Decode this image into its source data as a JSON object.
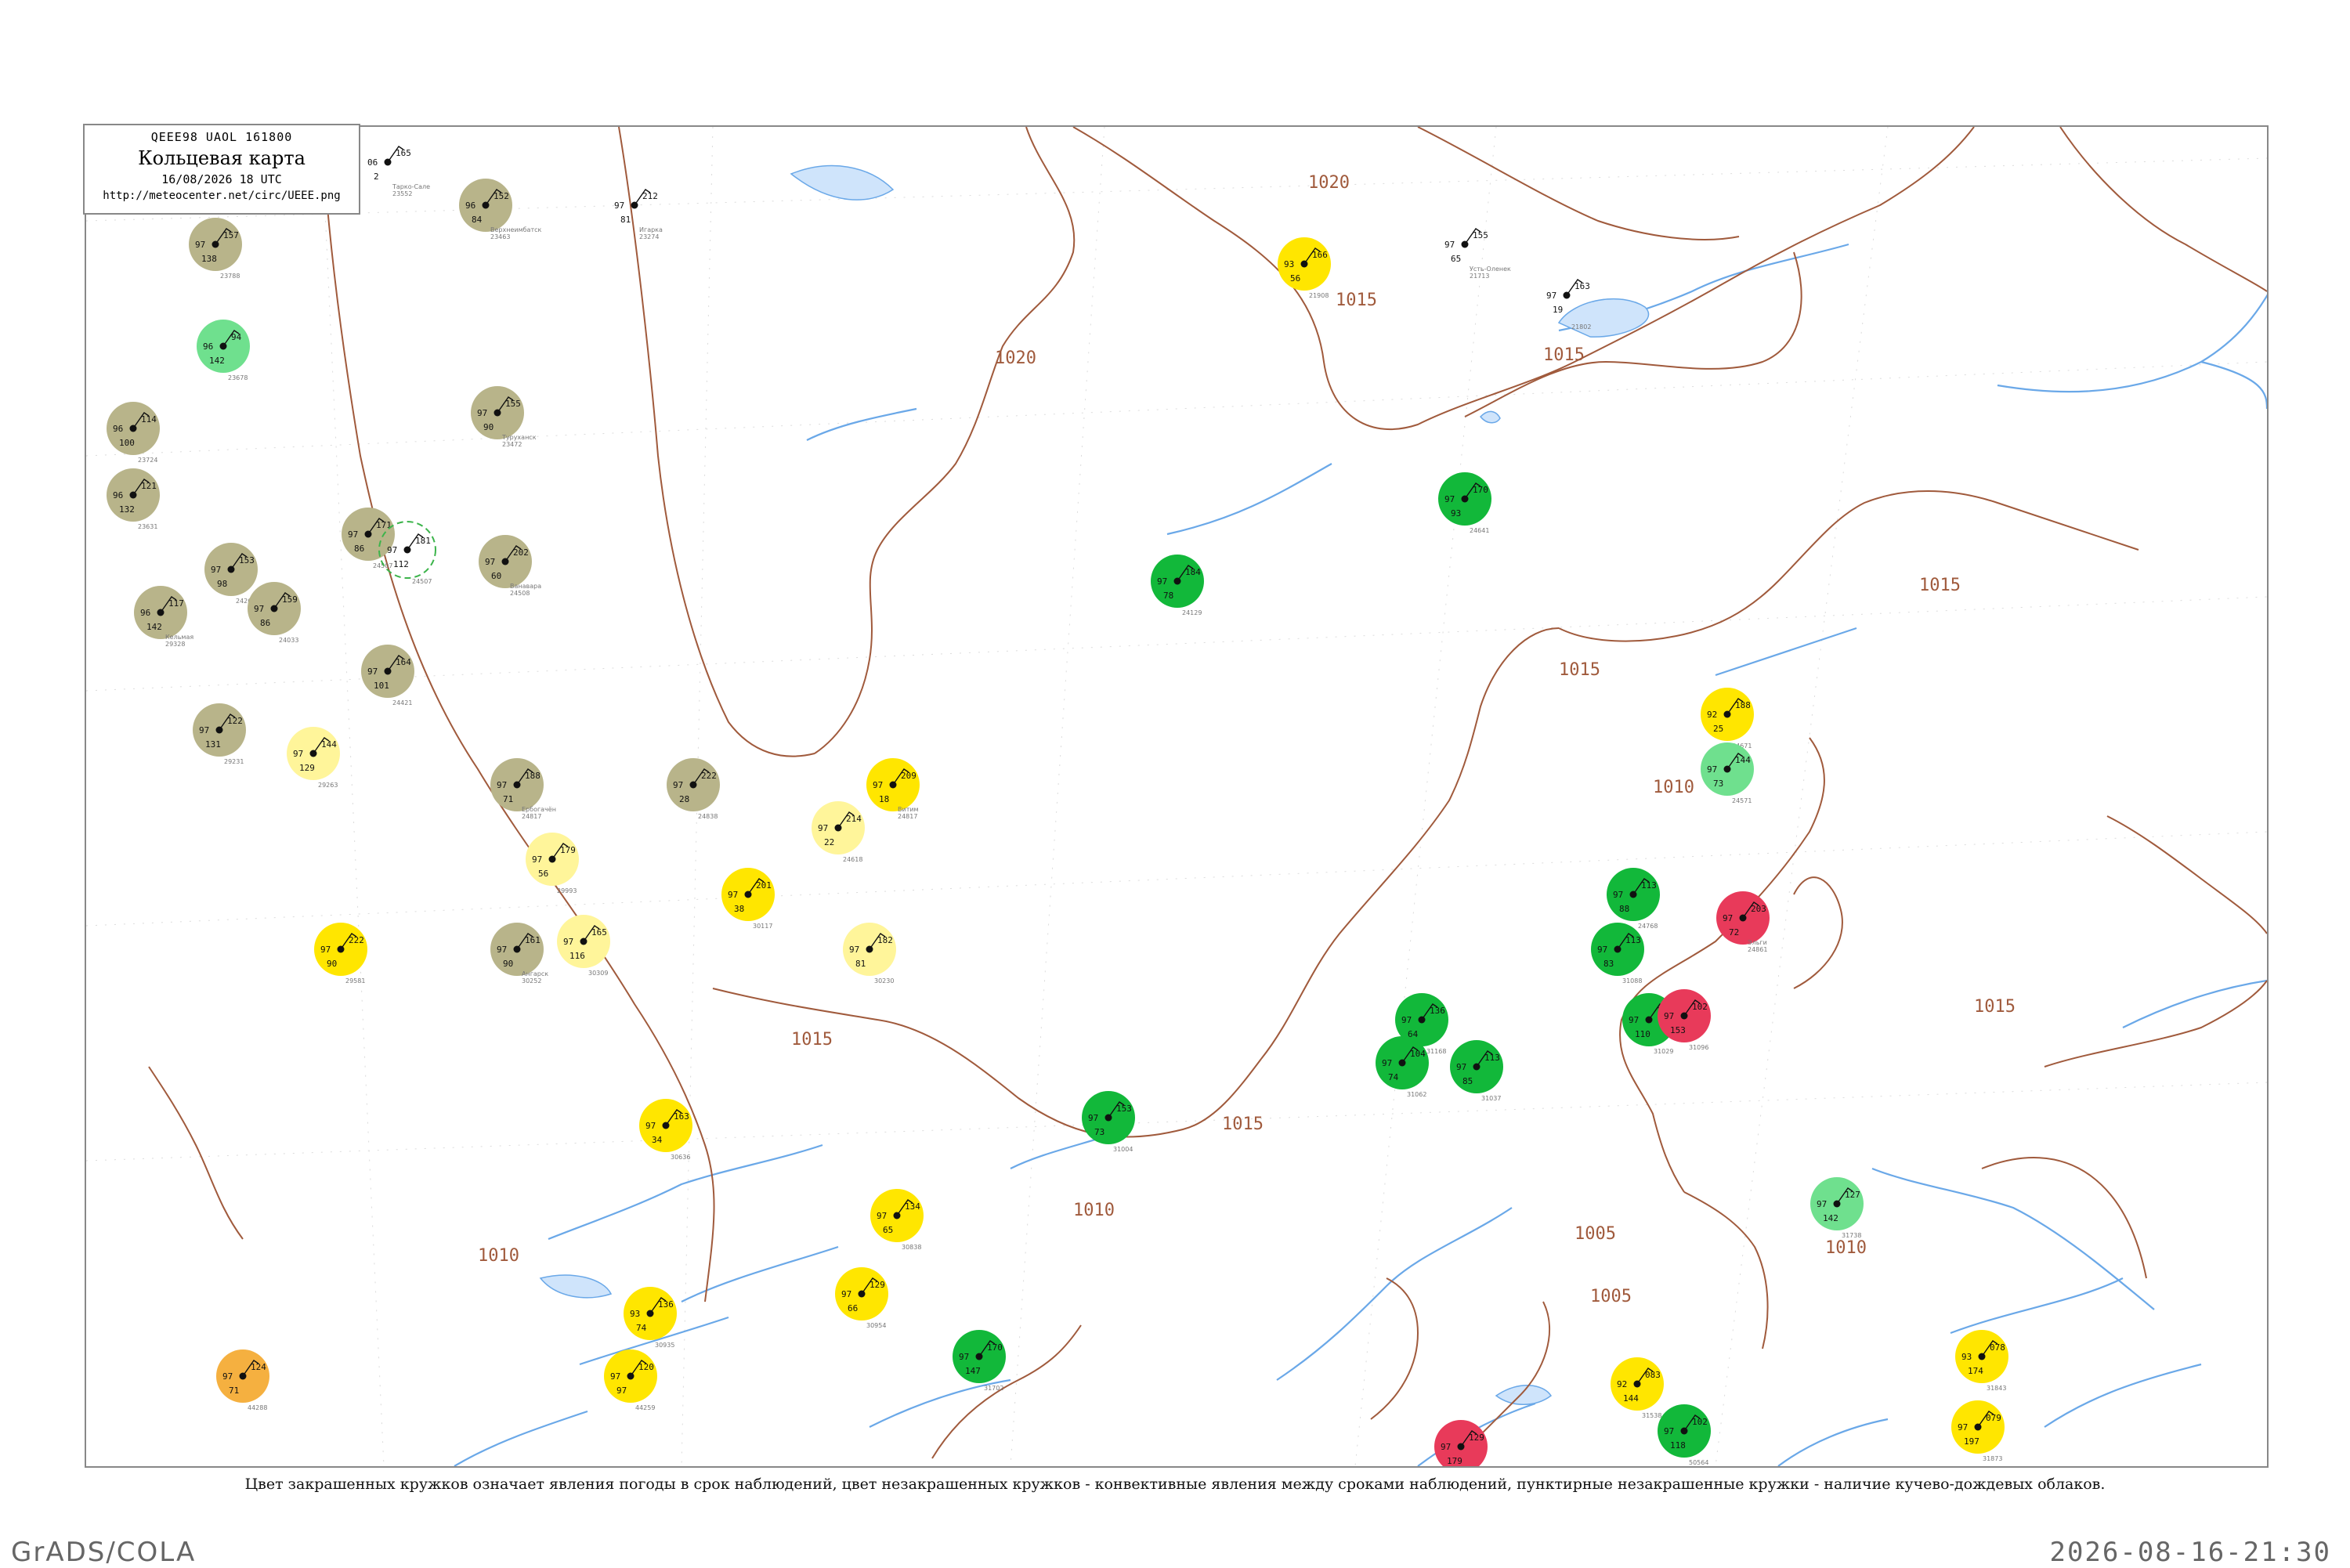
{
  "header": {
    "code": "QEEE98  UAOL  161800",
    "title": "Кольцевая карта",
    "datetime": "16/08/2026 18 UTC",
    "url": "http://meteocenter.net/circ/UEEE.png"
  },
  "caption": "Цвет закрашенных кружков означает явления погоды в срок наблюдений, цвет незакрашенных кружков - конвективные явления между сроками наблюдений, пунктирные незакрашенные кружки - наличие кучево-дождевых облаков.",
  "footer": {
    "left": "GrADS/COLA",
    "right": "2026-08-16-21:30"
  },
  "colors": {
    "isobar": "#a05a3c",
    "river": "#6aa8e8",
    "olive": "#b8b48a",
    "yellow": "#ffe600",
    "pale_yellow": "#fff59a",
    "green": "#12b83a",
    "light_green": "#6fe08e",
    "red": "#e83a5a",
    "orange": "#f5b040",
    "dashed_green": "#3cb44b",
    "dashed_red": "#e05570"
  },
  "isobar_labels": [
    "1020",
    "1015",
    "1020",
    "1015",
    "1015",
    "1010",
    "1015",
    "1010",
    "1005",
    "1010",
    "1005",
    "1015",
    "1015",
    "1010",
    "1015"
  ],
  "stations": [
    {
      "t": "165",
      "p": "06",
      "v": "2",
      "name": "Тарко-Сале",
      "id": "23552",
      "style": "none"
    },
    {
      "t": "157",
      "p": "97",
      "v": "138",
      "name": "",
      "id": "23788",
      "style": "olive"
    },
    {
      "t": "152",
      "p": "96",
      "v": "84",
      "name": "Верхнеимбатск",
      "id": "23463",
      "style": "olive"
    },
    {
      "t": "212",
      "p": "97",
      "v": "81",
      "name": "Игарка",
      "id": "23274",
      "style": "none"
    },
    {
      "t": "166",
      "p": "93",
      "v": "56",
      "name": "",
      "id": "21908",
      "style": "yellow"
    },
    {
      "t": "155",
      "p": "97",
      "v": "65",
      "name": "Усть-Оленек",
      "id": "21713",
      "style": "none"
    },
    {
      "t": "163",
      "p": "97",
      "v": "19",
      "name": "",
      "id": "21802",
      "style": "none"
    },
    {
      "t": "94",
      "p": "96",
      "v": "142",
      "name": "",
      "id": "23678",
      "style": "light_green"
    },
    {
      "t": "114",
      "p": "96",
      "v": "100",
      "name": "",
      "id": "23724",
      "style": "olive"
    },
    {
      "t": "121",
      "p": "96",
      "v": "132",
      "name": "",
      "id": "23631",
      "style": "olive"
    },
    {
      "t": "155",
      "p": "97",
      "v": "90",
      "name": "Туруханск",
      "id": "23472",
      "style": "olive"
    },
    {
      "t": "171",
      "p": "97",
      "v": "86",
      "name": "",
      "id": "24507",
      "style": "olive"
    },
    {
      "t": "181",
      "p": "97",
      "v": "112",
      "name": "",
      "id": "24507",
      "style": "dashed_green"
    },
    {
      "t": "202",
      "p": "97",
      "v": "60",
      "name": "Ванавара",
      "id": "24508",
      "style": "olive"
    },
    {
      "t": "153",
      "p": "97",
      "v": "98",
      "name": "",
      "id": "24266",
      "style": "olive"
    },
    {
      "t": "159",
      "p": "97",
      "v": "86",
      "name": "",
      "id": "24033",
      "style": "olive"
    },
    {
      "t": "117",
      "p": "96",
      "v": "142",
      "name": "Кельмая",
      "id": "29328",
      "style": "olive"
    },
    {
      "t": "164",
      "p": "97",
      "v": "101",
      "name": "",
      "id": "24421",
      "style": "olive"
    },
    {
      "t": "122",
      "p": "97",
      "v": "131",
      "name": "",
      "id": "29231",
      "style": "olive"
    },
    {
      "t": "188",
      "p": "97",
      "v": "71",
      "name": "Ербогачён",
      "id": "24817",
      "style": "olive"
    },
    {
      "t": "222",
      "p": "97",
      "v": "28",
      "name": "",
      "id": "24838",
      "style": "olive"
    },
    {
      "t": "161",
      "p": "97",
      "v": "90",
      "name": "Ангарск",
      "id": "30252",
      "style": "olive"
    },
    {
      "t": "209",
      "p": "97",
      "v": "18",
      "name": "Витим",
      "id": "24817",
      "style": "yellow"
    },
    {
      "t": "214",
      "p": "97",
      "v": "22",
      "name": "",
      "id": "24618",
      "style": "pale_yellow"
    },
    {
      "t": "201",
      "p": "97",
      "v": "38",
      "name": "",
      "id": "30117",
      "style": "yellow"
    },
    {
      "t": "182",
      "p": "97",
      "v": "81",
      "name": "",
      "id": "30230",
      "style": "pale_yellow"
    },
    {
      "t": "179",
      "p": "97",
      "v": "56",
      "name": "",
      "id": "29993",
      "style": "pale_yellow"
    },
    {
      "t": "165",
      "p": "97",
      "v": "116",
      "name": "",
      "id": "30309",
      "style": "pale_yellow"
    },
    {
      "t": "163",
      "p": "97",
      "v": "34",
      "name": "",
      "id": "30636",
      "style": "yellow"
    },
    {
      "t": "134",
      "p": "97",
      "v": "65",
      "name": "",
      "id": "30838",
      "style": "yellow"
    },
    {
      "t": "129",
      "p": "97",
      "v": "66",
      "name": "",
      "id": "30954",
      "style": "yellow"
    },
    {
      "t": "136",
      "p": "93",
      "v": "74",
      "name": "",
      "id": "30935",
      "style": "yellow"
    },
    {
      "t": "120",
      "p": "97",
      "v": "97",
      "name": "",
      "id": "44259",
      "style": "yellow"
    },
    {
      "t": "222",
      "p": "97",
      "v": "90",
      "name": "",
      "id": "29581",
      "style": "yellow"
    },
    {
      "t": "144",
      "p": "97",
      "v": "129",
      "name": "",
      "id": "29263",
      "style": "pale_yellow"
    },
    {
      "t": "184",
      "p": "97",
      "v": "78",
      "name": "",
      "id": "24129",
      "style": "green"
    },
    {
      "t": "170",
      "p": "97",
      "v": "93",
      "name": "",
      "id": "24641",
      "style": "green"
    },
    {
      "t": "153",
      "p": "97",
      "v": "73",
      "name": "",
      "id": "31004",
      "style": "green"
    },
    {
      "t": "136",
      "p": "97",
      "v": "64",
      "name": "",
      "id": "31168",
      "style": "green"
    },
    {
      "t": "104",
      "p": "97",
      "v": "74",
      "name": "",
      "id": "31062",
      "style": "green"
    },
    {
      "t": "113",
      "p": "97",
      "v": "85",
      "name": "",
      "id": "31037",
      "style": "green"
    },
    {
      "t": "113",
      "p": "97",
      "v": "88",
      "name": "",
      "id": "24768",
      "style": "green"
    },
    {
      "t": "113",
      "p": "97",
      "v": "83",
      "name": "",
      "id": "31088",
      "style": "green"
    },
    {
      "t": "158",
      "p": "97",
      "v": "110",
      "name": "",
      "id": "31029",
      "style": "green"
    },
    {
      "t": "170",
      "p": "97",
      "v": "147",
      "name": "",
      "id": "31702",
      "style": "green"
    },
    {
      "t": "102",
      "p": "97",
      "v": "118",
      "name": "",
      "id": "50564",
      "style": "green"
    },
    {
      "t": "203",
      "p": "97",
      "v": "72",
      "name": "Эльги",
      "id": "24861",
      "style": "red"
    },
    {
      "t": "102",
      "p": "97",
      "v": "153",
      "name": "",
      "id": "31096",
      "style": "red"
    },
    {
      "t": "129",
      "p": "97",
      "v": "179",
      "name": "",
      "id": "31594",
      "style": "red"
    },
    {
      "t": "188",
      "p": "92",
      "v": "25",
      "name": "",
      "id": "24671",
      "style": "yellow"
    },
    {
      "t": "144",
      "p": "97",
      "v": "73",
      "name": "",
      "id": "24571",
      "style": "light_green"
    },
    {
      "t": "127",
      "p": "97",
      "v": "142",
      "name": "",
      "id": "31738",
      "style": "light_green"
    },
    {
      "t": "083",
      "p": "92",
      "v": "144",
      "name": "",
      "id": "31538",
      "style": "yellow"
    },
    {
      "t": "078",
      "p": "93",
      "v": "174",
      "name": "",
      "id": "31843",
      "style": "yellow"
    },
    {
      "t": "079",
      "p": "97",
      "v": "197",
      "name": "",
      "id": "31873",
      "style": "yellow"
    },
    {
      "t": "124",
      "p": "97",
      "v": "71",
      "name": "",
      "id": "44288",
      "style": "orange"
    }
  ]
}
